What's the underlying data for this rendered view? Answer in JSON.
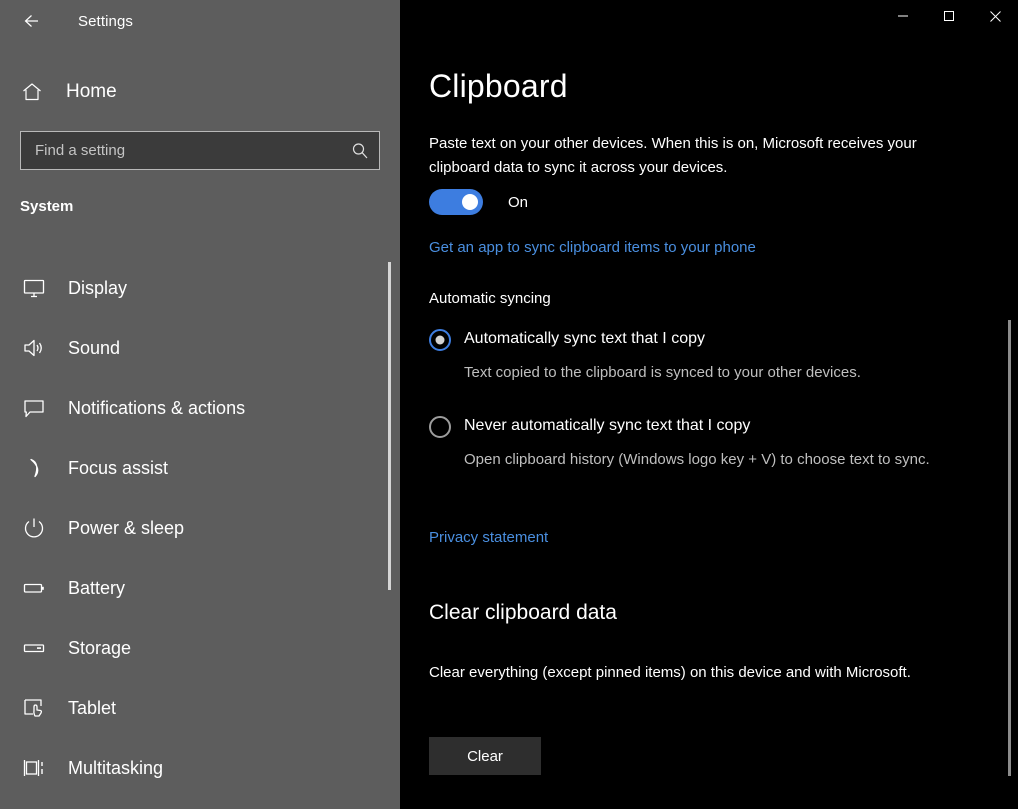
{
  "window": {
    "app_title": "Settings",
    "back_icon": "back-arrow-icon",
    "controls": {
      "minimize": "minimize-icon",
      "maximize": "maximize-icon",
      "close": "close-icon"
    }
  },
  "sidebar": {
    "home_label": "Home",
    "home_icon": "home-icon",
    "search": {
      "placeholder": "Find a setting",
      "value": "",
      "icon": "search-icon"
    },
    "section_title": "System",
    "items": [
      {
        "label": "Display",
        "icon": "monitor-icon"
      },
      {
        "label": "Sound",
        "icon": "speaker-icon"
      },
      {
        "label": "Notifications & actions",
        "icon": "comment-icon"
      },
      {
        "label": "Focus assist",
        "icon": "moon-icon"
      },
      {
        "label": "Power & sleep",
        "icon": "power-icon"
      },
      {
        "label": "Battery",
        "icon": "battery-icon"
      },
      {
        "label": "Storage",
        "icon": "drive-icon"
      },
      {
        "label": "Tablet",
        "icon": "tablet-touch-icon"
      },
      {
        "label": "Multitasking",
        "icon": "multitasking-icon"
      }
    ]
  },
  "main": {
    "title": "Clipboard",
    "description": "Paste text on your other devices. When this is on, Microsoft receives your clipboard data to sync it across your devices.",
    "toggle": {
      "state_label": "On",
      "on": true
    },
    "sync_app_link": "Get an app to sync clipboard items to your phone",
    "automatic_syncing_label": "Automatic syncing",
    "radio_options": [
      {
        "label": "Automatically sync text that I copy",
        "description": "Text copied to the clipboard is synced to your other devices.",
        "selected": true
      },
      {
        "label": "Never automatically sync text that I copy",
        "description": "Open clipboard history (Windows logo key + V) to choose text to sync.",
        "selected": false
      }
    ],
    "privacy_link": "Privacy statement",
    "clear_section": {
      "heading": "Clear clipboard data",
      "description": "Clear everything (except pinned items) on this device and with Microsoft.",
      "button_label": "Clear"
    }
  },
  "colors": {
    "accent": "#3d7de0",
    "link": "#4a8fe0",
    "sidebar_bg": "#5d5d5d",
    "content_bg": "#000000",
    "button_bg": "#2e2e2e"
  }
}
